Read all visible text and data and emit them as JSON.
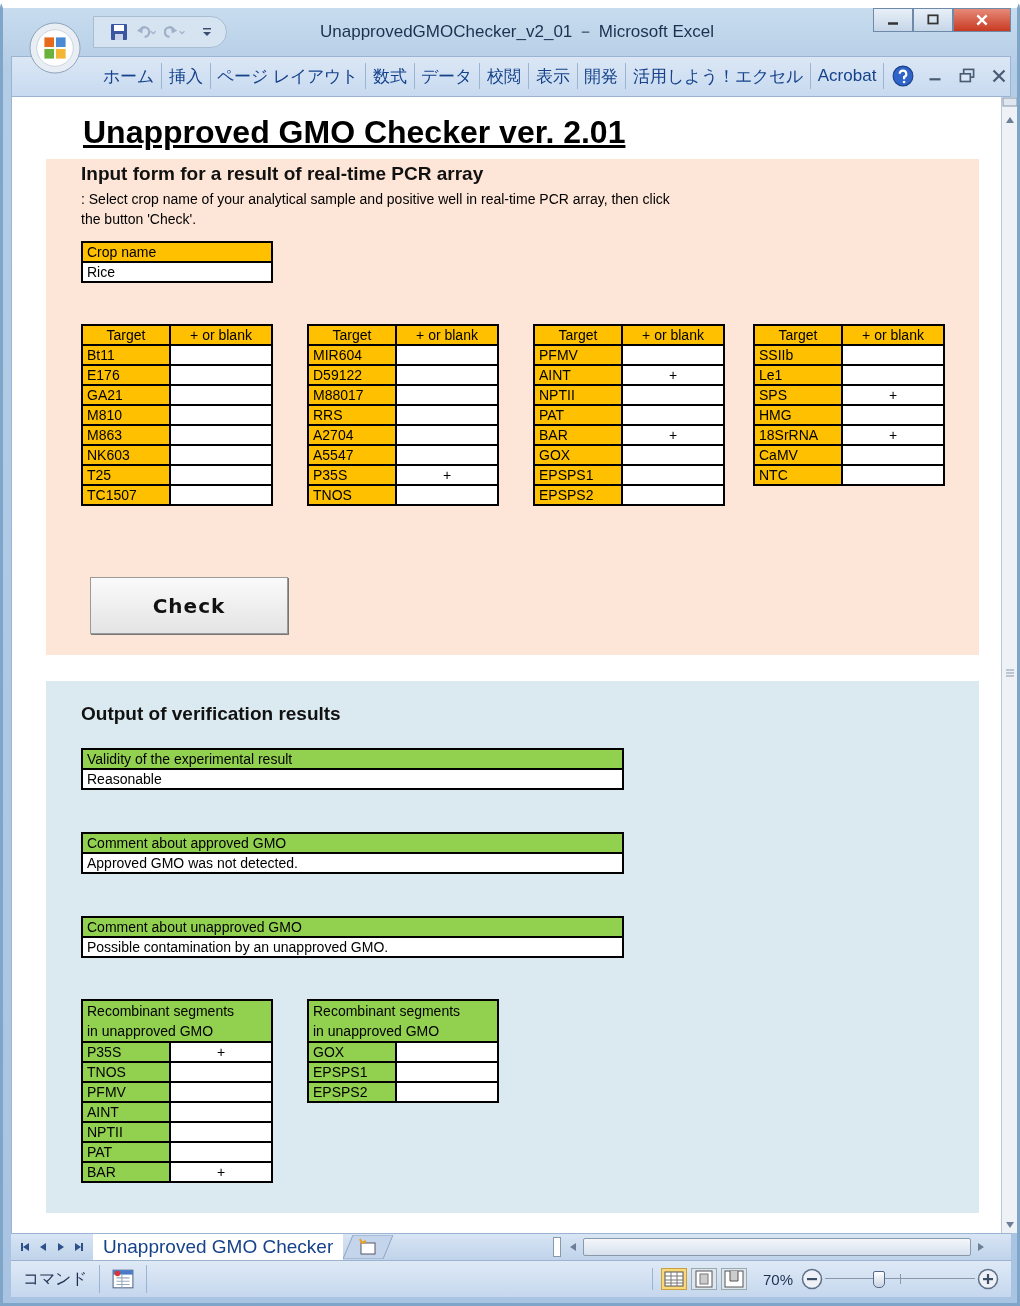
{
  "window": {
    "title": "UnapprovedGMOChecker_v2_01 － Microsoft Excel"
  },
  "ribbon_tabs": [
    {
      "label": "ホーム"
    },
    {
      "label": "挿入"
    },
    {
      "label": "ページ レイアウト"
    },
    {
      "label": "数式"
    },
    {
      "label": "データ"
    },
    {
      "label": "校閲"
    },
    {
      "label": "表示"
    },
    {
      "label": "開発"
    },
    {
      "label": "活用しよう！エクセル"
    },
    {
      "label": "Acrobat"
    }
  ],
  "sheet": {
    "title": "Unapproved GMO Checker ver. 2.01",
    "input_panel": {
      "heading": "Input form for a result of real-time PCR array",
      "instruction": ": Select crop name of your analytical sample and positive well in real-time PCR array, then click the button 'Check'.",
      "crop": {
        "label": "Crop name",
        "value": "Rice"
      },
      "target_tables": [
        {
          "columns": [
            "Target",
            "+ or blank"
          ],
          "rows": [
            {
              "target": "Bt11"
            },
            {
              "target": "E176"
            },
            {
              "target": "GA21"
            },
            {
              "target": "M810"
            },
            {
              "target": "M863"
            },
            {
              "target": "NK603"
            },
            {
              "target": "T25"
            },
            {
              "target": "TC1507"
            }
          ]
        },
        {
          "columns": [
            "Target",
            "+ or blank"
          ],
          "rows": [
            {
              "target": "MIR604"
            },
            {
              "target": "D59122"
            },
            {
              "target": "M88017"
            },
            {
              "target": "RRS"
            },
            {
              "target": "A2704"
            },
            {
              "target": "A5547"
            },
            {
              "target": "P35S",
              "mark": "+"
            },
            {
              "target": "TNOS"
            }
          ]
        },
        {
          "columns": [
            "Target",
            "+ or blank"
          ],
          "rows": [
            {
              "target": "PFMV"
            },
            {
              "target": "AINT",
              "mark": "+"
            },
            {
              "target": "NPTII"
            },
            {
              "target": "PAT"
            },
            {
              "target": "BAR",
              "mark": "+"
            },
            {
              "target": "GOX"
            },
            {
              "target": "EPSPS1"
            },
            {
              "target": "EPSPS2"
            }
          ]
        },
        {
          "columns": [
            "Target",
            "+ or blank"
          ],
          "rows": [
            {
              "target": "SSIIb"
            },
            {
              "target": "Le1"
            },
            {
              "target": "SPS",
              "mark": "+"
            },
            {
              "target": "HMG"
            },
            {
              "target": "18SrRNA",
              "mark": "+"
            },
            {
              "target": "CaMV"
            },
            {
              "target": "NTC"
            }
          ]
        }
      ],
      "button": "Check"
    },
    "output_panel": {
      "heading": "Output of verification results",
      "results": [
        {
          "label": "Validity of the experimental result",
          "value": "Reasonable"
        },
        {
          "label": "Comment about approved GMO",
          "value": "Approved GMO was not detected."
        },
        {
          "label": "Comment about unapproved GMO",
          "value": "Possible contamination by an unapproved GMO."
        }
      ],
      "segment_tables": [
        {
          "header": "Recombinant segments in unapproved GMO",
          "rows": [
            {
              "target": "P35S",
              "mark": "+"
            },
            {
              "target": "TNOS"
            },
            {
              "target": "PFMV"
            },
            {
              "target": "AINT"
            },
            {
              "target": "NPTII"
            },
            {
              "target": "PAT"
            },
            {
              "target": "BAR",
              "mark": "+"
            }
          ]
        },
        {
          "header": "Recombinant segments in unapproved GMO",
          "rows": [
            {
              "target": "GOX"
            },
            {
              "target": "EPSPS1"
            },
            {
              "target": "EPSPS2"
            }
          ]
        }
      ]
    }
  },
  "sheet_tabs": [
    {
      "label": "Unapproved GMO Checker",
      "selected": true
    }
  ],
  "status_bar": {
    "mode": "コマンド",
    "zoom": "70%",
    "zoom_slider": {
      "level": 0.35
    }
  }
}
